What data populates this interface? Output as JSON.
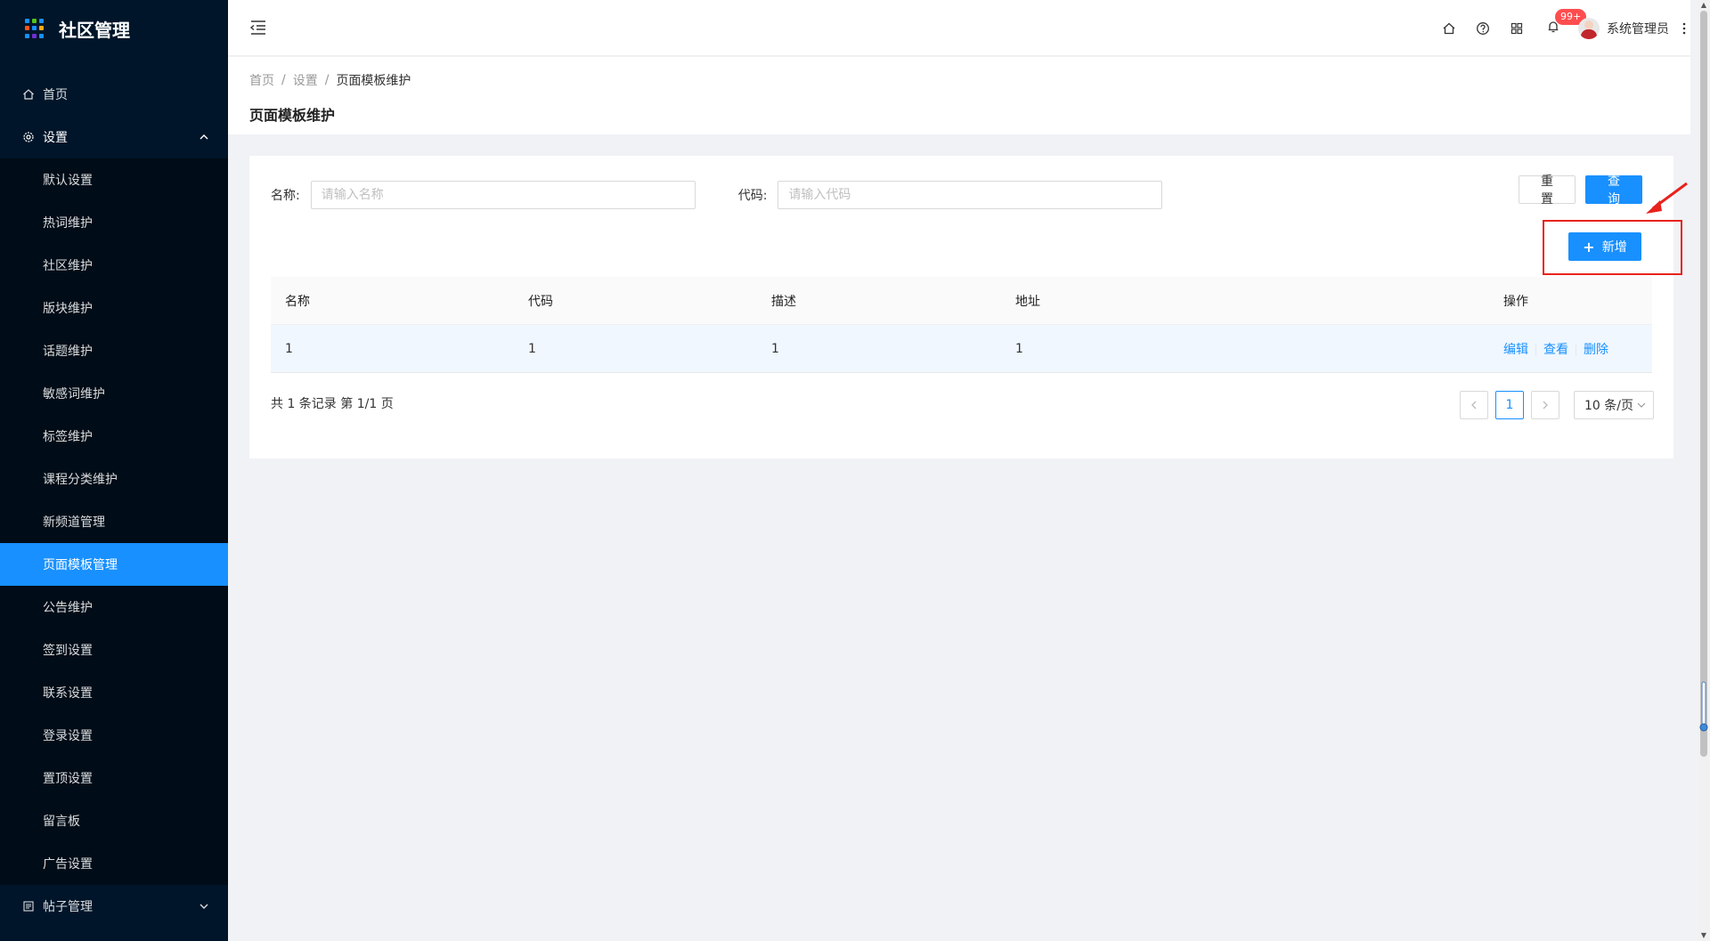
{
  "app": {
    "title": "社区管理",
    "logo_colors": [
      "#1890ff",
      "#52c41a",
      "#1890ff",
      "#fa541c",
      "#1890ff",
      "#faad14",
      "#1890ff",
      "#722ed1",
      "#1890ff"
    ]
  },
  "sidebar": {
    "home": {
      "label": "首页",
      "icon": "home-icon"
    },
    "settings": {
      "label": "设置",
      "icon": "gear-icon",
      "items": [
        {
          "label": "默认设置"
        },
        {
          "label": "热词维护"
        },
        {
          "label": "社区维护"
        },
        {
          "label": "版块维护"
        },
        {
          "label": "话题维护"
        },
        {
          "label": "敏感词维护"
        },
        {
          "label": "标签维护"
        },
        {
          "label": "课程分类维护"
        },
        {
          "label": "新频道管理"
        },
        {
          "label": "页面模板管理"
        },
        {
          "label": "公告维护"
        },
        {
          "label": "签到设置"
        },
        {
          "label": "联系设置"
        },
        {
          "label": "登录设置"
        },
        {
          "label": "置顶设置"
        },
        {
          "label": "留言板"
        },
        {
          "label": "广告设置"
        }
      ],
      "active_index": 9
    },
    "posts": {
      "label": "帖子管理",
      "icon": "list-icon"
    }
  },
  "header": {
    "notification_badge": "99+",
    "user_name": "系统管理员"
  },
  "breadcrumb": [
    "首页",
    "设置",
    "页面模板维护"
  ],
  "page_title": "页面模板维护",
  "search": {
    "name_label": "名称:",
    "name_placeholder": "请输入名称",
    "code_label": "代码:",
    "code_placeholder": "请输入代码",
    "reset_label": "重 置",
    "query_label": "查 询",
    "add_label": "新增"
  },
  "table": {
    "columns": [
      "名称",
      "代码",
      "描述",
      "地址",
      "操作"
    ],
    "rows": [
      {
        "name": "1",
        "code": "1",
        "desc": "1",
        "address": "1"
      }
    ],
    "actions": [
      "编辑",
      "查看",
      "删除"
    ]
  },
  "pagination": {
    "summary": "共 1 条记录 第 1/1 页",
    "current_page": "1",
    "page_size": "10 条/页"
  },
  "colors": {
    "primary": "#1890ff",
    "sidebar_bg": "#001529",
    "annotation": "#e8221c"
  }
}
